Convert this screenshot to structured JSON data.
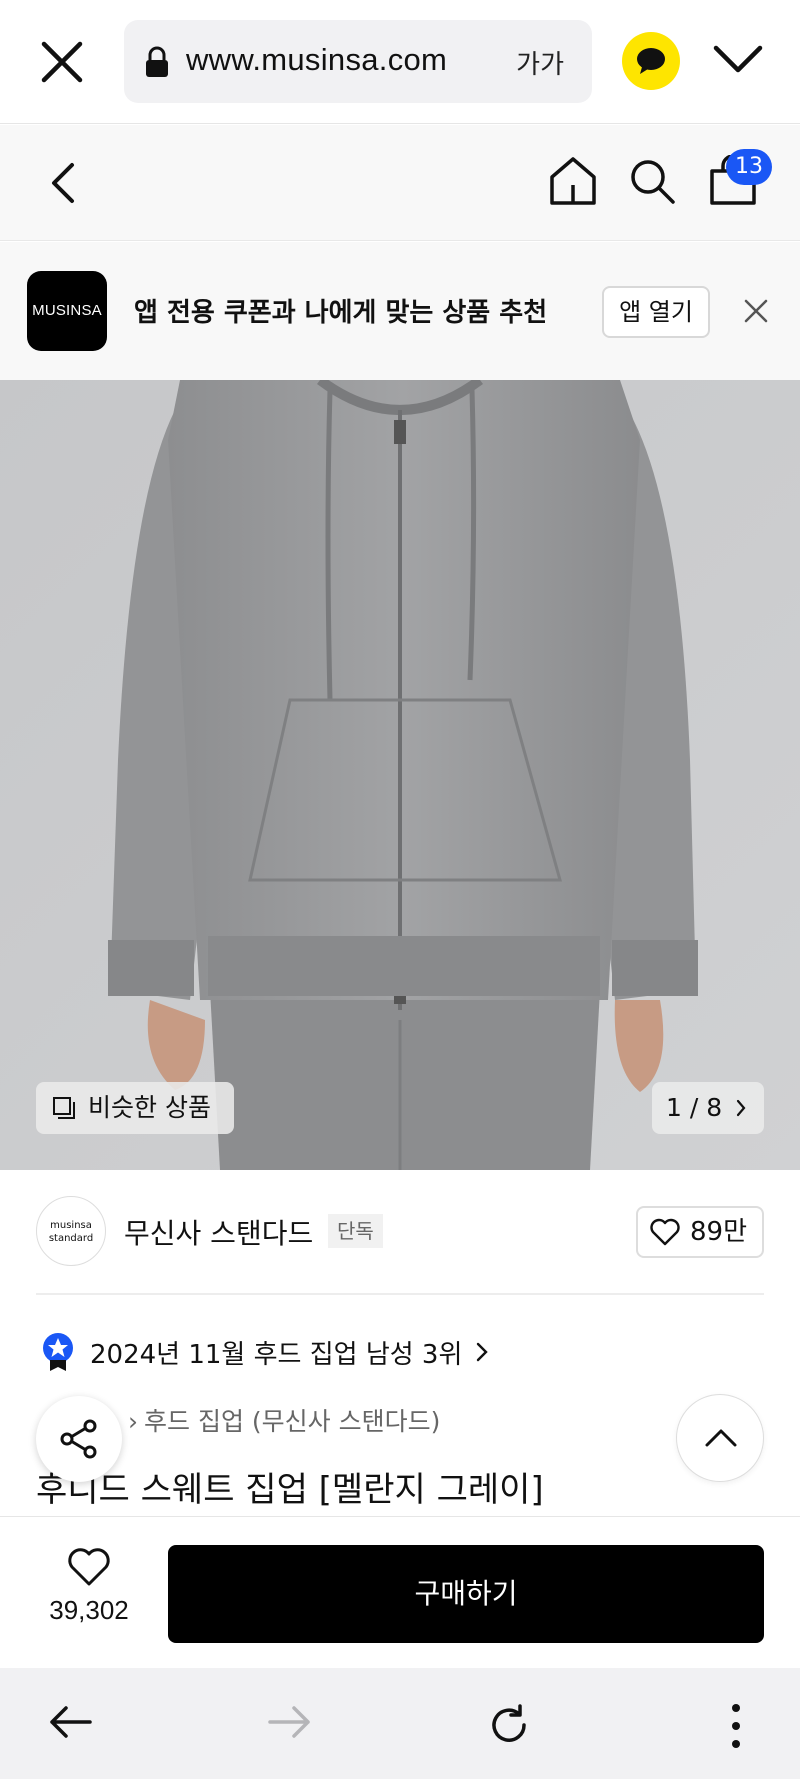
{
  "browser": {
    "url": "www.musinsa.com",
    "text_size_label": "가가",
    "icons": [
      "close-icon",
      "lock-icon",
      "kakaotalk-icon",
      "chevron-down-icon"
    ]
  },
  "header": {
    "cart_count": "13",
    "icons": [
      "back-icon",
      "home-icon",
      "search-icon",
      "cart-icon"
    ]
  },
  "promo": {
    "logo_text": "MUSINSA",
    "message": "앱 전용 쿠폰과 나에게 맞는 상품 추천",
    "open_label": "앱 열기"
  },
  "gallery": {
    "similar_label": "비슷한 상품",
    "page_indicator": "1 / 8",
    "current_page": 1,
    "total_pages": 8
  },
  "brand": {
    "logo_line1": "musinsa",
    "logo_line2": "standard",
    "name": "무신사 스탠다드",
    "badge": "단독",
    "likes": "89만"
  },
  "rank": {
    "text": "2024년 11월 후드 집업 남성 3위"
  },
  "product": {
    "category": "후드 집업 (무신사 스탠다드)",
    "title": "후디드 스웨트 집업 [멜란지 그레이]"
  },
  "bottom": {
    "wish_count": "39,302",
    "buy_label": "구매하기"
  },
  "colors": {
    "badge_blue": "#1a57f5",
    "kakao_yellow": "#fee500",
    "buy_button": "#000000"
  }
}
